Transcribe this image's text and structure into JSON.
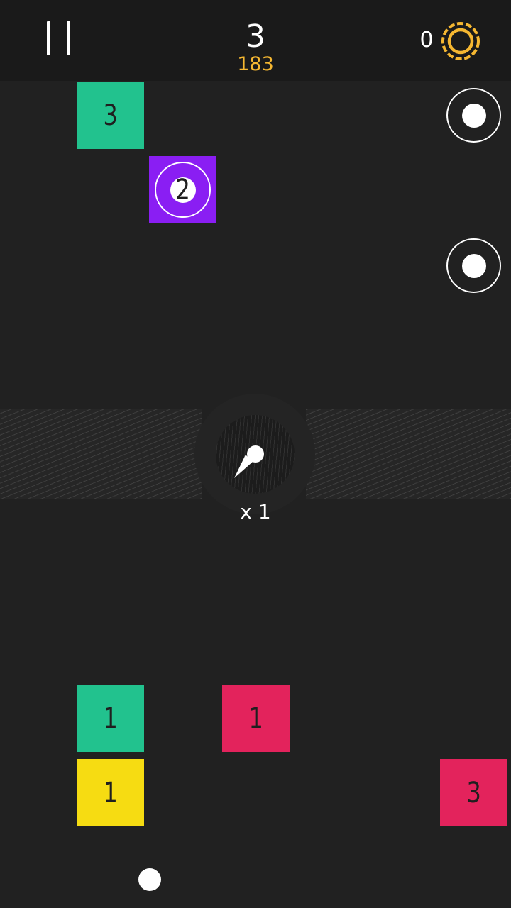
{
  "header": {
    "level": "3",
    "best_score": "183",
    "coins": "0",
    "pause_icon": "pause-icon",
    "coin_icon": "coin-icon"
  },
  "blocks": [
    {
      "value": "3",
      "color": "#22c28e"
    },
    {
      "value": "2",
      "color": "#8a1ef3"
    },
    {
      "value": "1",
      "color": "#22c28e"
    },
    {
      "value": "1",
      "color": "#e3235c"
    },
    {
      "value": "1",
      "color": "#f6dc12"
    },
    {
      "value": "3",
      "color": "#e3235c"
    }
  ],
  "launcher": {
    "multiplier": "x 1",
    "icon": "ball-launch-icon"
  },
  "colors": {
    "background": "#212121",
    "topbar": "#1a1a1a",
    "best_score": "#f5b731",
    "coin": "#f5b731"
  }
}
